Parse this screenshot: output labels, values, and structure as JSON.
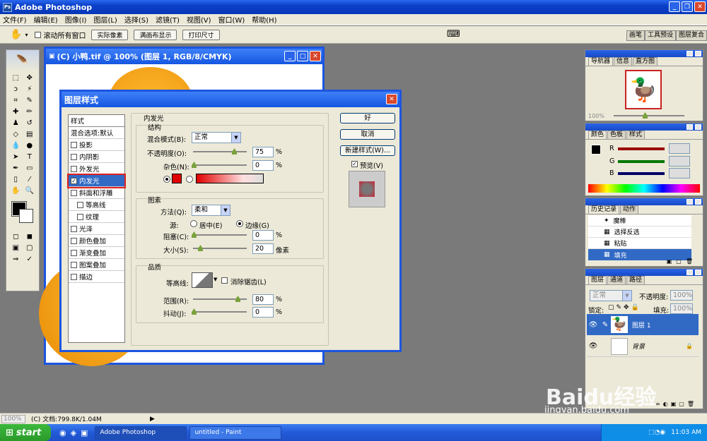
{
  "app": {
    "title": "Adobe Photoshop"
  },
  "menu": [
    "文件(F)",
    "编辑(E)",
    "图像(I)",
    "图层(L)",
    "选择(S)",
    "滤镜(T)",
    "视图(V)",
    "窗口(W)",
    "帮助(H)"
  ],
  "options": {
    "scroll_all": "滚动所有窗口",
    "actual_pixels": "实际像素",
    "fit_screen": "满画布显示",
    "print_size": "打印尺寸"
  },
  "well_tabs": [
    "画笔",
    "工具预设",
    "图层复合"
  ],
  "document": {
    "title": "(C) 小鸭.tif @ 100% (图层 1, RGB/8/CMYK)"
  },
  "dialog": {
    "title": "图层样式",
    "styles": [
      "样式",
      "混合选项:默认",
      "投影",
      "内阴影",
      "外发光",
      "内发光",
      "斜面和浮雕",
      "等高线",
      "纹理",
      "光泽",
      "颜色叠加",
      "渐变叠加",
      "图案叠加",
      "描边"
    ],
    "section_title": "内发光",
    "structure": {
      "title": "结构",
      "blend_label": "混合模式(B):",
      "blend_value": "正常",
      "opacity_label": "不透明度(O):",
      "opacity_value": "75",
      "noise_label": "杂色(N):",
      "noise_value": "0",
      "pct": "%"
    },
    "elements": {
      "title": "图素",
      "method_label": "方法(Q):",
      "method_value": "柔和",
      "source_label": "源:",
      "center": "居中(E)",
      "edge": "边缘(G)",
      "choke_label": "阻塞(C):",
      "choke_value": "0",
      "size_label": "大小(S):",
      "size_value": "20",
      "px": "像素"
    },
    "quality": {
      "title": "品质",
      "contour_label": "等高线:",
      "antialias": "消除锯齿(L)",
      "range_label": "范围(R):",
      "range_value": "80",
      "jitter_label": "抖动(J):",
      "jitter_value": "0"
    },
    "buttons": {
      "ok": "好",
      "cancel": "取消",
      "new_style": "新建样式(W)...",
      "preview": "预览(V)"
    },
    "glow_color": "#e00000"
  },
  "navigator": {
    "tabs": [
      "导航器",
      "信息",
      "直方图"
    ],
    "zoom": "100%"
  },
  "color_panel": {
    "tabs": [
      "颜色",
      "色板",
      "样式"
    ],
    "channels": [
      "R",
      "G",
      "B"
    ]
  },
  "history": {
    "tabs": [
      "历史记录",
      "动作"
    ],
    "items": [
      "魔棒",
      "选择反选",
      "粘贴",
      "填充"
    ]
  },
  "layers": {
    "tabs": [
      "图层",
      "通道",
      "路径"
    ],
    "blend": "正常",
    "opacity_label": "不透明度:",
    "opacity": "100%",
    "lock_label": "锁定:",
    "fill_label": "填充:",
    "fill": "100%",
    "items": [
      "图层 1",
      "背景"
    ]
  },
  "status": {
    "zoom": "100%",
    "doc": "(C) 文档:799.8K/1.04M"
  },
  "taskbar": {
    "start": "start",
    "tasks": [
      "Adobe Photoshop",
      "untitled - Paint"
    ],
    "lang": "EN",
    "time": "11:03 AM"
  },
  "watermark": {
    "brand": "Baidu经验",
    "url": "jingyan.baidu.com"
  }
}
